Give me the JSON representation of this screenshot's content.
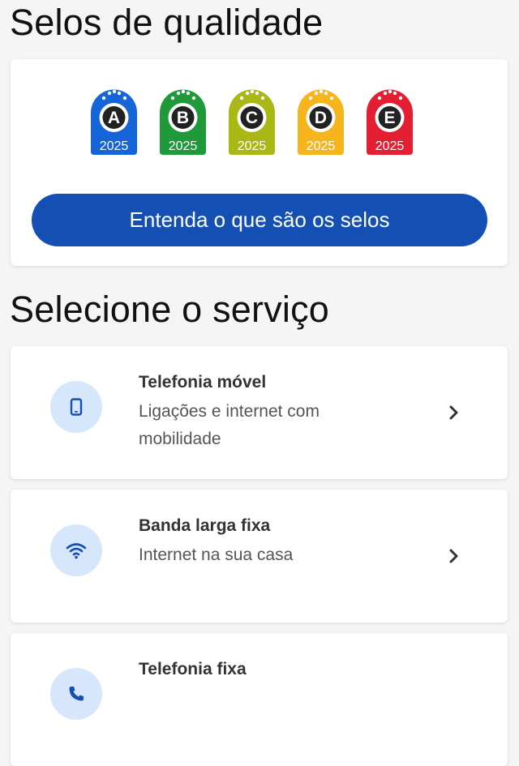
{
  "seals_section": {
    "title": "Selos de qualidade",
    "seals": [
      {
        "letter": "A",
        "year": "2025",
        "color": "#1565d8"
      },
      {
        "letter": "B",
        "year": "2025",
        "color": "#1f9a3a"
      },
      {
        "letter": "C",
        "year": "2025",
        "color": "#a9b814"
      },
      {
        "letter": "D",
        "year": "2025",
        "color": "#f6b51c"
      },
      {
        "letter": "E",
        "year": "2025",
        "color": "#e41f32"
      }
    ],
    "button_label": "Entenda o que são os selos"
  },
  "services_section": {
    "title": "Selecione o serviço",
    "items": [
      {
        "title": "Telefonia móvel",
        "description": "Ligações e internet com mobilidade",
        "icon": "smartphone-icon"
      },
      {
        "title": "Banda larga fixa",
        "description": "Internet na sua casa",
        "icon": "wifi-icon"
      },
      {
        "title": "Telefonia fixa",
        "description": "",
        "icon": "phone-icon"
      }
    ]
  },
  "colors": {
    "primary": "#1450b3",
    "icon_bg": "#d6e6fb",
    "icon_fg": "#1450b3"
  }
}
